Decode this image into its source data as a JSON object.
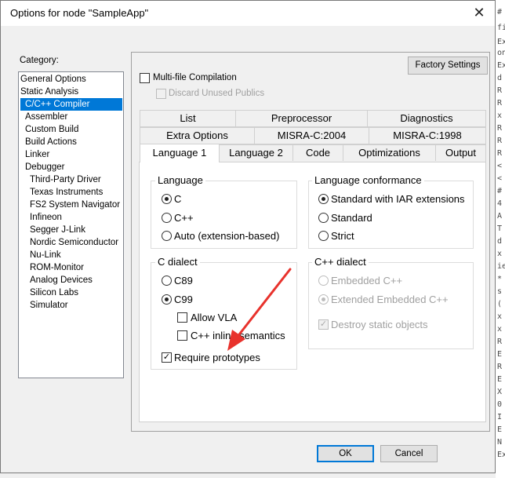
{
  "window": {
    "title": "Options for node \"SampleApp\"",
    "close_glyph": "✕"
  },
  "category": {
    "label": "Category:",
    "items": [
      "General Options",
      "Static Analysis",
      "C/C++ Compiler",
      "Assembler",
      "Custom Build",
      "Build Actions",
      "Linker",
      "Debugger",
      "Third-Party Driver",
      "Texas Instruments",
      "FS2 System Navigator",
      "Infineon",
      "Segger J-Link",
      "Nordic Semiconductor",
      "Nu-Link",
      "ROM-Monitor",
      "Analog Devices",
      "Silicon Labs",
      "Simulator"
    ],
    "selected": "C/C++ Compiler"
  },
  "top": {
    "factory_settings": "Factory Settings",
    "multifile": "Multi-file Compilation",
    "discard": "Discard Unused Publics"
  },
  "tabs": {
    "row1": [
      "List",
      "Preprocessor",
      "Diagnostics"
    ],
    "row2": [
      "Extra Options",
      "MISRA-C:2004",
      "MISRA-C:1998"
    ],
    "row3": [
      "Language 1",
      "Language 2",
      "Code",
      "Optimizations",
      "Output"
    ],
    "active": "Language 1"
  },
  "language": {
    "title": "Language",
    "options": [
      "C",
      "C++",
      "Auto (extension-based)"
    ],
    "selected": "C"
  },
  "conformance": {
    "title": "Language conformance",
    "options": [
      "Standard with IAR extensions",
      "Standard",
      "Strict"
    ],
    "selected": "Standard with IAR extensions"
  },
  "c_dialect": {
    "title": "C dialect",
    "options": [
      "C89",
      "C99"
    ],
    "selected": "C99",
    "allow_vla": "Allow VLA",
    "inline_semantics": "C++ inline semantics",
    "require_prototypes": "Require prototypes",
    "check_glyph": "✓"
  },
  "cpp_dialect": {
    "title": "C++ dialect",
    "options": [
      "Embedded C++",
      "Extended Embedded C++"
    ],
    "selected": "Extended Embedded C++",
    "destroy_static": "Destroy static objects"
  },
  "buttons": {
    "ok": "OK",
    "cancel": "Cancel"
  },
  "background_fragments": [
    "#",
    "fi",
    "Ex",
    "on",
    "Ex",
    "d",
    "R",
    "R",
    "x",
    "R",
    "R",
    "R",
    "<",
    "<",
    "#",
    "4",
    "A",
    "T",
    "d",
    "x",
    "ie",
    "*",
    "s",
    "(",
    "x",
    "x",
    "R",
    "E",
    "R",
    "E",
    "X",
    "0",
    "I",
    "E",
    "N",
    "Ex"
  ],
  "annotation": {
    "arrow_color": "#e8322c"
  }
}
